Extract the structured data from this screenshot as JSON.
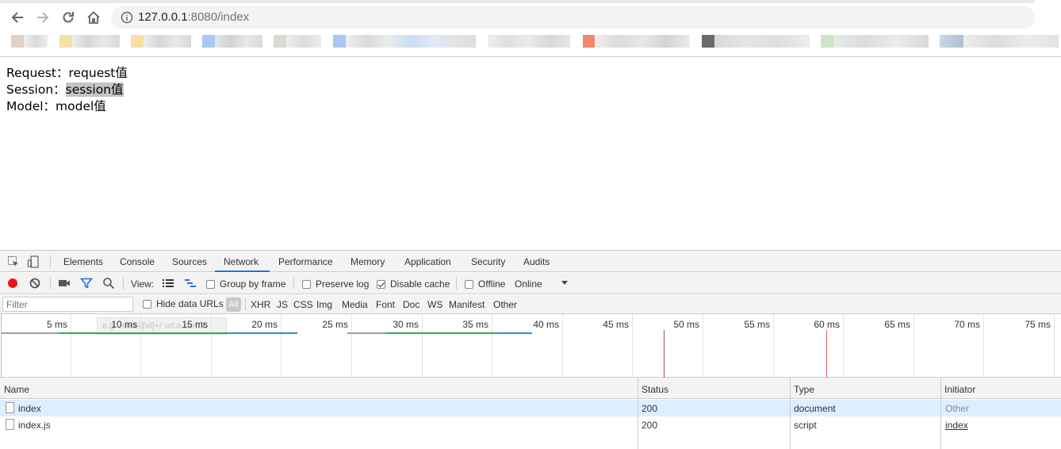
{
  "browser": {
    "url_host": "127.0.0.1",
    "url_rest": ":8080/index"
  },
  "page": {
    "lines": [
      {
        "label": "Request：",
        "value": "request值"
      },
      {
        "label": "Session：",
        "value": "session值"
      },
      {
        "label": "Model：",
        "value": "model值"
      }
    ]
  },
  "devtools": {
    "tabs": [
      "Elements",
      "Console",
      "Sources",
      "Network",
      "Performance",
      "Memory",
      "Application",
      "Security",
      "Audits"
    ],
    "active_tab": "Network",
    "toolbar": {
      "view_label": "View:",
      "group_by_frame": "Group by frame",
      "preserve_log": "Preserve log",
      "disable_cache": "Disable cache",
      "offline": "Offline",
      "throttle": "Online"
    },
    "filter": {
      "placeholder": "Filter",
      "hide_data_urls": "Hide data URLs",
      "all": "All",
      "types": [
        "XHR",
        "JS",
        "CSS",
        "Img",
        "Media",
        "Font",
        "Doc",
        "WS",
        "Manifest",
        "Other"
      ],
      "ghost_hint": "e.g. /small[\\d]+/ url:a.com/b"
    },
    "timeline_ticks": [
      "5 ms",
      "10 ms",
      "15 ms",
      "20 ms",
      "25 ms",
      "30 ms",
      "35 ms",
      "40 ms",
      "45 ms",
      "50 ms",
      "55 ms",
      "60 ms",
      "65 ms",
      "70 ms",
      "75 ms"
    ],
    "table": {
      "headers": [
        "Name",
        "Status",
        "Type",
        "Initiator"
      ],
      "rows": [
        {
          "name": "index",
          "status": "200",
          "type": "document",
          "initiator": "Other"
        },
        {
          "name": "index.js",
          "status": "200",
          "type": "script",
          "initiator": "index"
        }
      ]
    }
  },
  "colors": {
    "record": "#e8141a",
    "tab_active": "#1a73e8",
    "selected_row": "#ddeeff",
    "bar_green": "#1db45b",
    "bar_blue": "#1a95d8",
    "marker_red": "#e06060"
  }
}
